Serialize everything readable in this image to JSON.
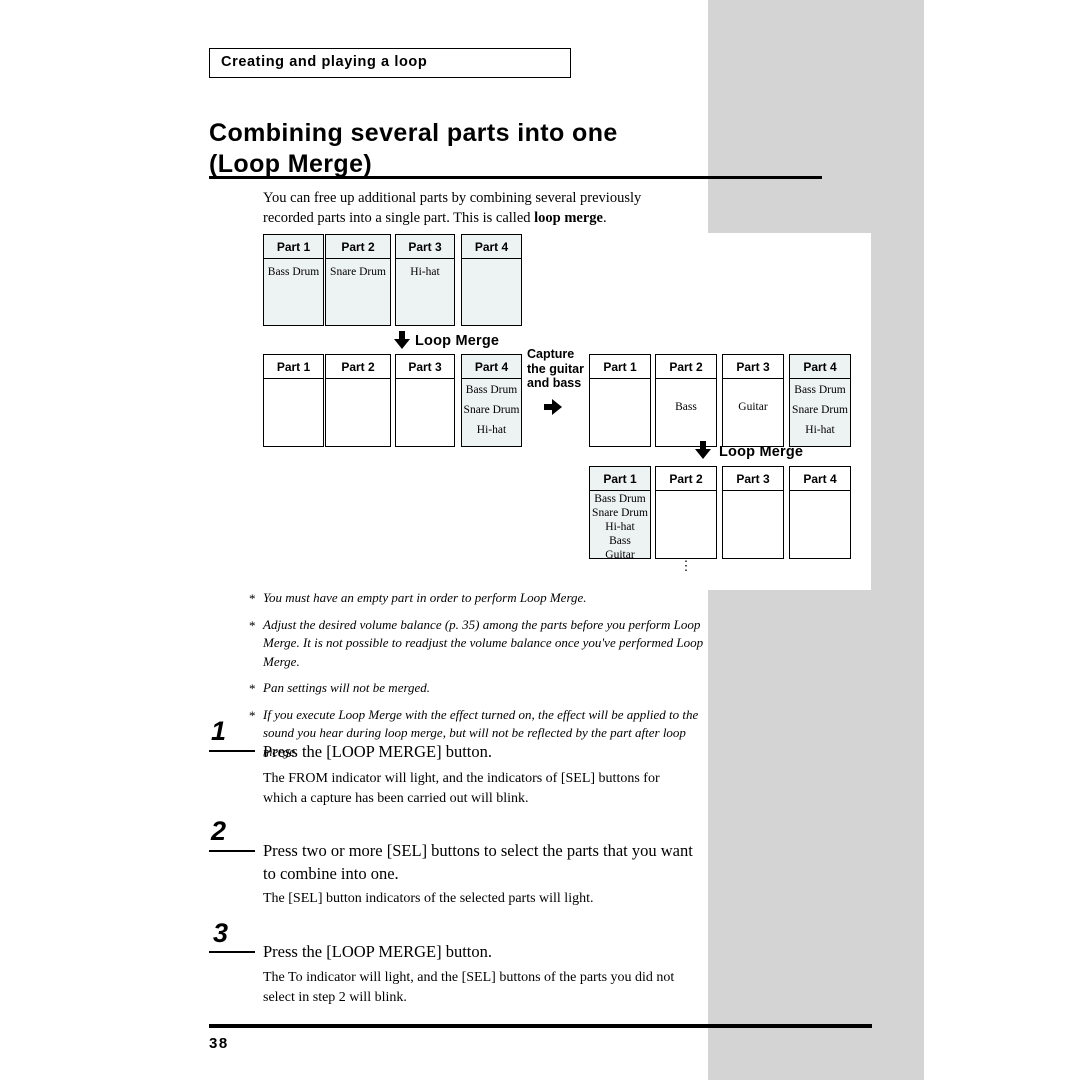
{
  "header": {
    "chapter": "Creating and playing a loop"
  },
  "title": {
    "line1": "Combining several parts into one",
    "line2": "(Loop Merge)"
  },
  "intro": {
    "text_before": "You can free up additional parts by combining several previously recorded parts into a single part. This is called ",
    "bold": "loop merge",
    "text_after": "."
  },
  "diagram": {
    "merge_label_1": "Loop Merge",
    "merge_label_2": "Loop Merge",
    "capture_label": "Capture the guitar and bass",
    "row1": [
      {
        "header": "Part 1",
        "lines": [
          "Bass Drum"
        ]
      },
      {
        "header": "Part 2",
        "lines": [
          "Snare Drum"
        ]
      },
      {
        "header": "Part 3",
        "lines": [
          "Hi-hat"
        ]
      },
      {
        "header": "Part 4",
        "lines": []
      }
    ],
    "row2": [
      {
        "header": "Part 1",
        "lines": []
      },
      {
        "header": "Part 2",
        "lines": []
      },
      {
        "header": "Part 3",
        "lines": []
      },
      {
        "header": "Part 4",
        "lines": [
          "Bass Drum",
          "Snare Drum",
          "Hi-hat"
        ]
      }
    ],
    "row3": [
      {
        "header": "Part 1",
        "lines": []
      },
      {
        "header": "Part 2",
        "lines": [
          "Bass"
        ]
      },
      {
        "header": "Part 3",
        "lines": [
          "Guitar"
        ]
      },
      {
        "header": "Part 4",
        "lines": [
          "Bass Drum",
          "Snare Drum",
          "Hi-hat"
        ]
      }
    ],
    "row4": [
      {
        "header": "Part 1",
        "lines": [
          "Bass Drum",
          "Snare Drum",
          "Hi-hat",
          "Bass",
          "Guitar"
        ]
      },
      {
        "header": "Part 2",
        "lines": []
      },
      {
        "header": "Part 3",
        "lines": []
      },
      {
        "header": "Part 4",
        "lines": []
      }
    ],
    "dots": "⋮"
  },
  "notes": [
    "You must have an empty part in order to perform Loop Merge.",
    "Adjust the desired volume balance (p. 35) among the parts before you perform Loop Merge. It is not possible to readjust the volume balance once you've performed Loop Merge.",
    "Pan settings will not be merged.",
    "If you execute Loop Merge with the effect turned on, the effect will be applied to the sound you hear during loop merge, but will not be reflected by the part after loop merge."
  ],
  "steps": [
    {
      "num": "1",
      "title": "Press the [LOOP MERGE] button.",
      "body": "The FROM indicator will light, and the indicators of [SEL] buttons for which a capture has been carried out will blink."
    },
    {
      "num": "2",
      "title": "Press two or more [SEL] buttons to select the parts that you want to combine into one.",
      "body": "The [SEL] button indicators of the selected parts will light."
    },
    {
      "num": "3",
      "title": "Press the [LOOP MERGE] button.",
      "body": "The To indicator will light, and the [SEL] buttons of the parts you did not select in step 2 will blink."
    }
  ],
  "footer": {
    "page_number": "38"
  }
}
